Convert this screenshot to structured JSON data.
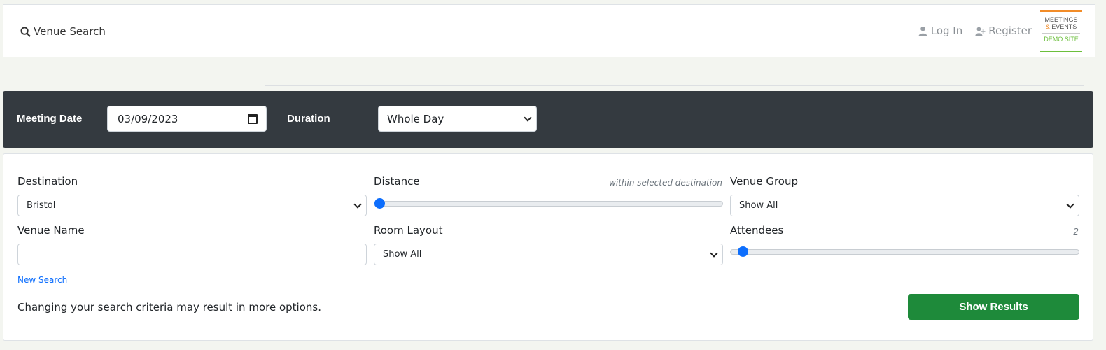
{
  "header": {
    "venue_search": "Venue Search",
    "login": "Log In",
    "register": "Register",
    "logo": {
      "line1": "MEETINGS",
      "amp": "&",
      "line2": "EVENTS",
      "line3": "DEMO SITE"
    }
  },
  "search_bar": {
    "meeting_date_label": "Meeting Date",
    "meeting_date_value": "03/09/2023",
    "duration_label": "Duration",
    "duration_value": "Whole Day"
  },
  "filters": {
    "destination_label": "Destination",
    "destination_value": "Bristol",
    "distance_label": "Distance",
    "distance_hint": "within selected destination",
    "venue_group_label": "Venue Group",
    "venue_group_value": "Show All",
    "venue_name_label": "Venue Name",
    "venue_name_value": "",
    "room_layout_label": "Room Layout",
    "room_layout_value": "Show All",
    "attendees_label": "Attendees",
    "attendees_value": "2",
    "new_search": "New Search",
    "note": "Changing your search criteria may result in more options.",
    "show_results": "Show Results"
  },
  "colors": {
    "dark_bar": "#343a40",
    "accent_blue": "#0d6efd",
    "results_button": "#1e8a3a",
    "logo_orange": "#f28c28",
    "logo_green": "#6cbf3c"
  },
  "icons": [
    "search-icon",
    "user-icon",
    "user-plus-icon",
    "calendar-icon",
    "chevron-down-icon"
  ]
}
